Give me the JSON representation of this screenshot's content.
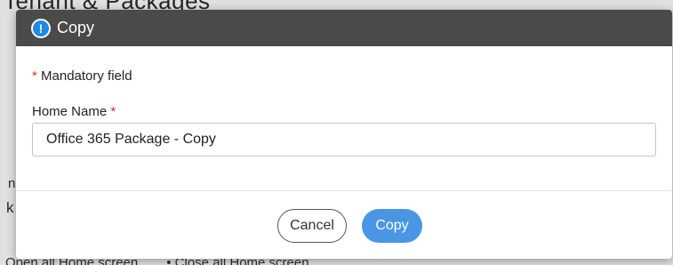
{
  "background": {
    "bottom_left_text": "Open all Home screen",
    "bottom_right_text": "Close all Home screen"
  },
  "dialog": {
    "icon": "info-icon",
    "title": "Copy",
    "mandatory_asterisk": "*",
    "mandatory_note": "Mandatory field",
    "home_name_label": "Home Name",
    "home_name_required_marker": "*",
    "home_name_value": "Office 365 Package - Copy",
    "cancel_label": "Cancel",
    "copy_label": "Copy"
  },
  "colors": {
    "header_bg": "#4a4a4a",
    "primary_button": "#4a96e5",
    "required_asterisk": "#d93025",
    "info_icon": "#1e88e5"
  }
}
